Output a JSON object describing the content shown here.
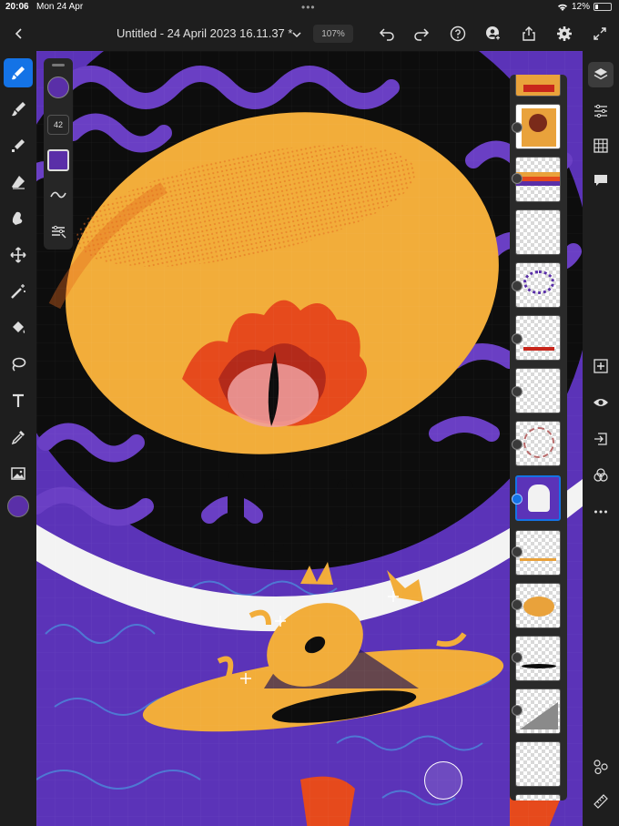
{
  "status": {
    "time": "20:06",
    "date": "Mon 24 Apr",
    "battery": "12%"
  },
  "topbar": {
    "title": "Untitled - 24 April 2023 16.11.37 *",
    "zoom": "107%"
  },
  "brush": {
    "size": "42"
  },
  "colors": {
    "accent": "#1473e6",
    "brush_color": "#5a2fa8",
    "canvas_purple": "#5b33b8",
    "artwork_orange": "#f2ad3a"
  },
  "left_tools": [
    "brush-icon",
    "paint-brush-icon",
    "pixel-brush-icon",
    "eraser-icon",
    "smudge-icon",
    "move-icon",
    "magic-wand-icon",
    "fill-icon",
    "lasso-icon",
    "text-icon",
    "eyedropper-icon",
    "image-icon"
  ],
  "right_tools": [
    "layers-icon",
    "layer-properties-icon",
    "grid-icon",
    "comments-icon",
    "add-layer-icon",
    "visibility-icon",
    "import-icon",
    "blend-icon",
    "more-icon",
    "fx-icon",
    "ruler-icon"
  ],
  "layers": {
    "count": 14,
    "selected_index": 8
  }
}
